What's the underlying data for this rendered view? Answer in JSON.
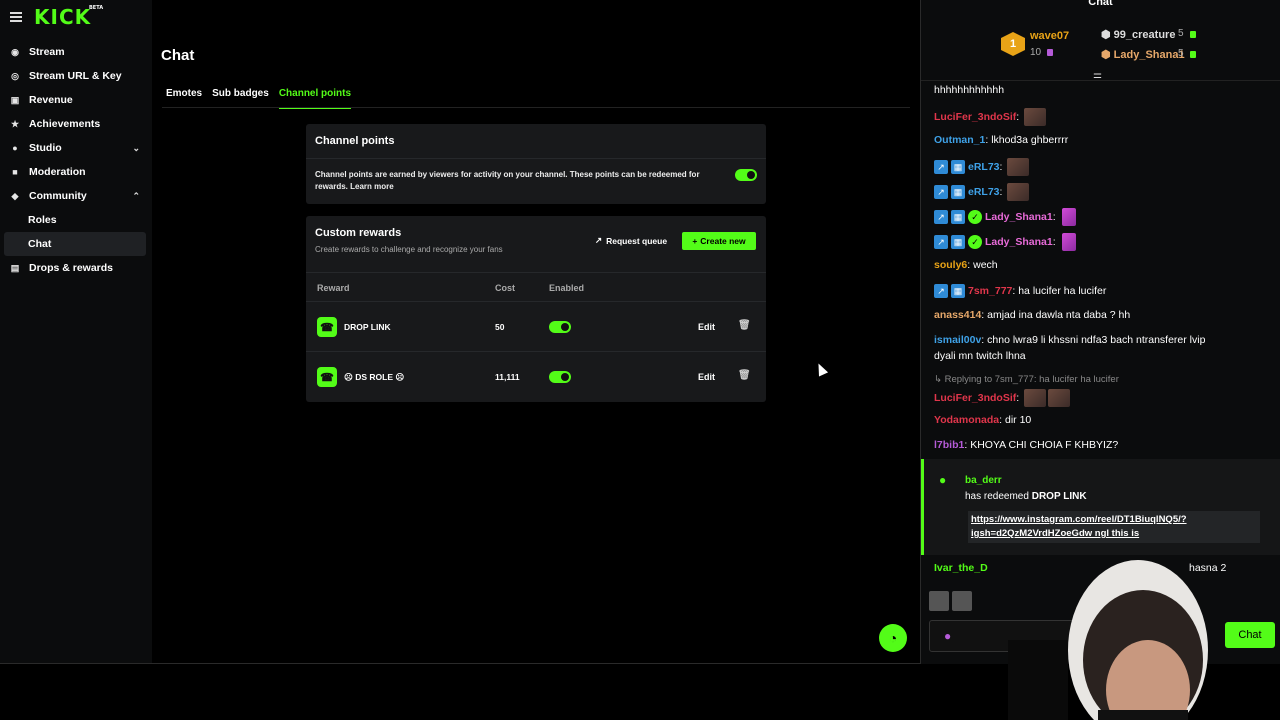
{
  "brand": {
    "logo": "KICK",
    "beta": "BETA"
  },
  "sidebar": {
    "items": [
      {
        "label": "Stream",
        "icon": "broadcast-icon"
      },
      {
        "label": "Stream URL & Key",
        "icon": "key-icon"
      },
      {
        "label": "Revenue",
        "icon": "revenue-icon"
      },
      {
        "label": "Achievements",
        "icon": "trophy-icon"
      },
      {
        "label": "Studio",
        "icon": "studio-icon",
        "chevron": "down"
      },
      {
        "label": "Moderation",
        "icon": "moderation-icon"
      },
      {
        "label": "Community",
        "icon": "community-icon",
        "chevron": "up"
      },
      {
        "label": "Roles",
        "sub": true
      },
      {
        "label": "Chat",
        "sub": true,
        "active": true
      },
      {
        "label": "Drops & rewards",
        "icon": "gift-icon"
      }
    ]
  },
  "main": {
    "title": "Chat",
    "tabs": [
      "Emotes",
      "Sub badges",
      "Channel points"
    ],
    "active_tab": "Channel points",
    "channel_points": {
      "title": "Channel points",
      "description": "Channel points are earned by viewers for activity on your channel. These points can be redeemed for rewards.",
      "learn_more": "Learn more",
      "enabled": true
    },
    "custom_rewards": {
      "title": "Custom rewards",
      "subtitle": "Create rewards to challenge and recognize your fans",
      "request_queue": "Request queue",
      "create_new": "Create new",
      "columns": [
        "Reward",
        "Cost",
        "Enabled"
      ],
      "rows": [
        {
          "name": "DROP LINK",
          "cost": "50",
          "enabled": true,
          "edit": "Edit"
        },
        {
          "name": "☹ DS ROLE ☹",
          "cost": "11,111",
          "enabled": true,
          "edit": "Edit"
        }
      ]
    }
  },
  "chat": {
    "title": "Chat",
    "leaderboard": {
      "first": {
        "rank": "1",
        "name": "wave07",
        "points": "10"
      },
      "second": {
        "name": "99_creature",
        "points": "5"
      },
      "third": {
        "name": "Lady_Shana1",
        "points": "5"
      }
    },
    "messages": [
      {
        "user": "",
        "text": "hhhhhhhhhhhh",
        "color": "#ffffff"
      },
      {
        "user": "LuciFer_3ndoSif",
        "text": "",
        "color": "#e0364b",
        "emotes": 1
      },
      {
        "user": "Outman_1",
        "text": "lkhod3a ghberrrr",
        "color": "#3fa2e8"
      },
      {
        "user": "eRL73",
        "text": "",
        "color": "#3fa2e8",
        "badges": 2,
        "emotes": 1
      },
      {
        "user": "eRL73",
        "text": "",
        "color": "#3fa2e8",
        "badges": 2,
        "emotes": 1
      },
      {
        "user": "Lady_Shana1",
        "text": "",
        "color": "#e86bd8",
        "badges": 3,
        "pink": 1
      },
      {
        "user": "Lady_Shana1",
        "text": "",
        "color": "#e86bd8",
        "badges": 3,
        "pink": 1
      },
      {
        "user": "souly6",
        "text": "wech",
        "color": "#e8a317"
      },
      {
        "user": "7sm_777",
        "text": "ha lucifer ha lucifer",
        "color": "#e0364b",
        "badges": 2
      },
      {
        "user": "anass414",
        "text": "amjad ina dawla nta daba ? hh",
        "color": "#e6a86a"
      },
      {
        "user": "ismail00v",
        "text": "chno lwra9 li khssni ndfa3 bach ntransferer lvip",
        "text2": "dyali mn twitch lhna",
        "color": "#3fa2e8"
      }
    ],
    "reply_to": "Replying to 7sm_777: ha lucifer ha lucifer",
    "after_reply": [
      {
        "user": "LuciFer_3ndoSif",
        "text": "",
        "color": "#e0364b",
        "emotes": 2
      },
      {
        "user": "Yodamonada",
        "text": "dir 10",
        "color": "#e0364b"
      },
      {
        "user": "l7bib1",
        "text": "KHOYA CHI CHOIA F KHBYIZ?",
        "color": "#b55bd8"
      }
    ],
    "redeem": {
      "user": "ba_derr",
      "action": "has redeemed",
      "reward": "DROP LINK",
      "link": "https://www.instagram.com/reel/DT1BiuqlNQ5/?igsh=d2QzM2VrdHZoeGdw ngl this is"
    },
    "bottom_user": "Ivar_the_D",
    "bottom_text": "hasna 2",
    "send_label": "Chat"
  }
}
